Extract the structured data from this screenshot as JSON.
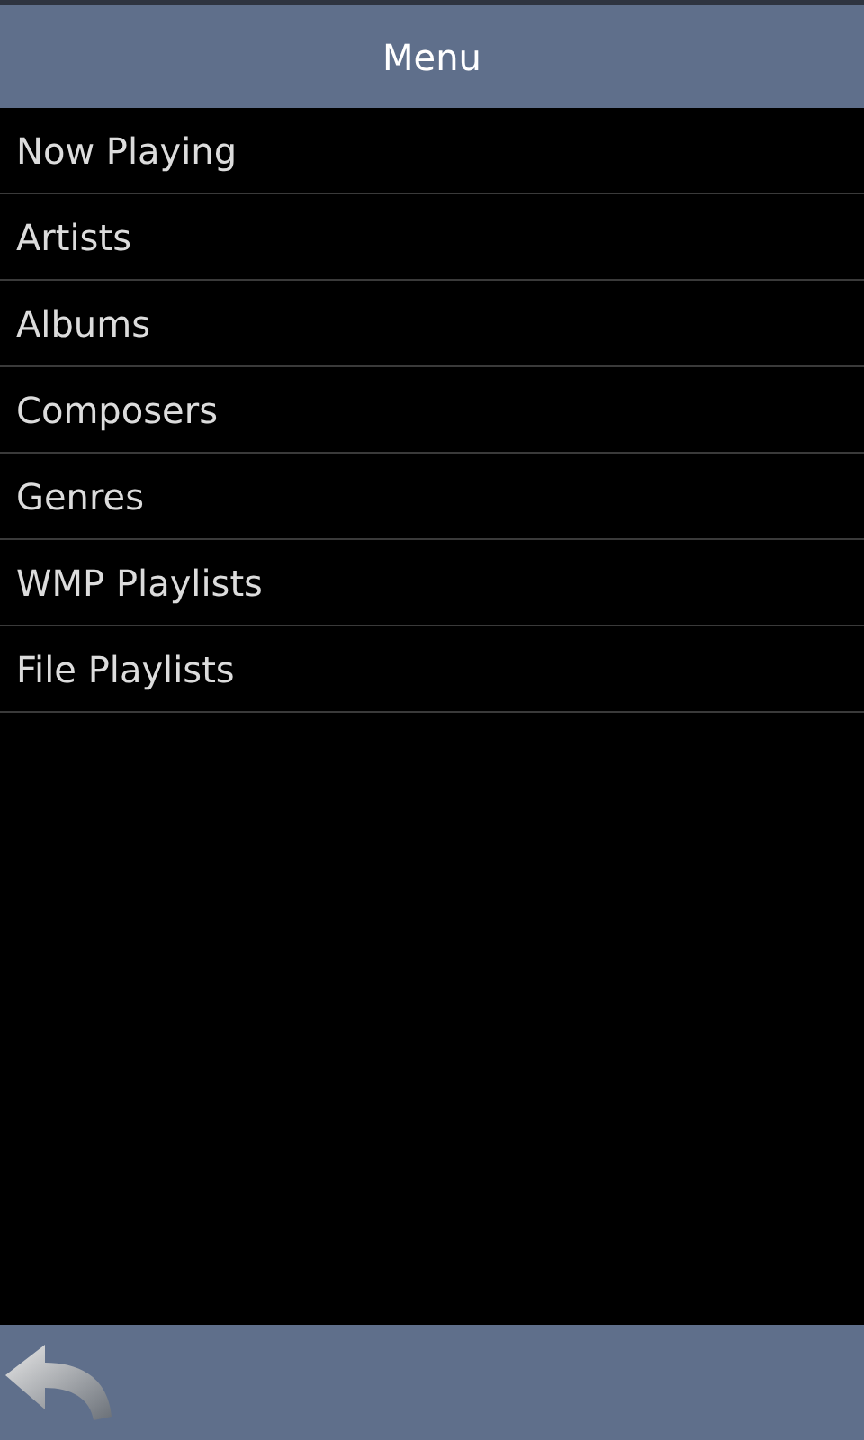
{
  "header": {
    "title": "Menu"
  },
  "menu": {
    "items": [
      {
        "label": "Now Playing"
      },
      {
        "label": "Artists"
      },
      {
        "label": "Albums"
      },
      {
        "label": "Composers"
      },
      {
        "label": "Genres"
      },
      {
        "label": "WMP Playlists"
      },
      {
        "label": "File Playlists"
      }
    ]
  }
}
